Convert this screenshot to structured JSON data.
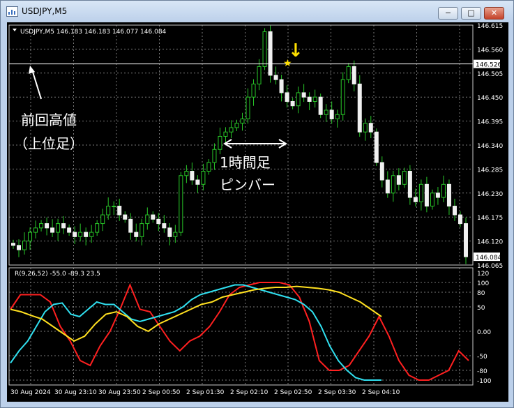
{
  "window": {
    "title": "USDJPY,M5",
    "buttons": {
      "minimize": "−",
      "maximize": "□",
      "close": "✕"
    }
  },
  "chart_data": {
    "type": "candlestick",
    "symbol_header": "USDJPY,M5  146.183 146.183 146.077 146.084",
    "price_axis": {
      "ylim": [
        146.065,
        146.615
      ],
      "ticks": [
        "146.615",
        "146.560",
        "146.505",
        "146.450",
        "146.395",
        "146.340",
        "146.285",
        "146.230",
        "146.175",
        "146.120",
        "146.065"
      ],
      "current_price": "146.084",
      "line_price": "146.526"
    },
    "time_axis": [
      "30 Aug 2024",
      "30 Aug 23:10",
      "30 Aug 23:50",
      "2 Sep 00:50",
      "2 Sep 01:30",
      "2 Sep 02:10",
      "2 Sep 02:50",
      "2 Sep 03:30",
      "2 Sep 04:10"
    ],
    "candle_close_series": [
      146.11,
      146.1,
      146.12,
      146.14,
      146.15,
      146.16,
      146.15,
      146.14,
      146.16,
      146.15,
      146.14,
      146.13,
      146.14,
      146.13,
      146.14,
      146.16,
      146.18,
      146.2,
      146.2,
      146.18,
      146.17,
      146.14,
      146.13,
      146.16,
      146.18,
      146.17,
      146.16,
      146.15,
      146.13,
      146.14,
      146.27,
      146.28,
      146.26,
      146.25,
      146.28,
      146.3,
      146.33,
      146.36,
      146.37,
      146.38,
      146.39,
      146.4,
      146.45,
      146.48,
      146.52,
      146.6,
      146.5,
      146.49,
      146.46,
      146.44,
      146.43,
      146.46,
      146.45,
      146.44,
      146.45,
      146.41,
      146.42,
      146.4,
      146.41,
      146.49,
      146.52,
      146.48,
      146.37,
      146.39,
      146.37,
      146.3,
      146.26,
      146.23,
      146.27,
      146.25,
      146.28,
      146.22,
      146.21,
      146.25,
      146.2,
      146.23,
      146.22,
      146.25,
      146.2,
      146.18,
      146.16,
      146.084
    ],
    "indicator": {
      "label": "R(9,26,52) -55.0 -89.3 23.5",
      "ylim": [
        -110,
        130
      ],
      "ticks": [
        "120",
        "100",
        "80",
        "50",
        "0.00",
        "-50",
        "-80",
        "-100"
      ],
      "series": [
        {
          "color": "#ff2020",
          "values": [
            45,
            75,
            75,
            75,
            60,
            10,
            -20,
            -60,
            -70,
            -30,
            0,
            45,
            95,
            45,
            40,
            10,
            -20,
            -40,
            -20,
            -10,
            10,
            40,
            75,
            90,
            95,
            100,
            100,
            100,
            95,
            70,
            20,
            -60,
            -80,
            -80,
            -70,
            -40,
            -10,
            30,
            -10,
            -60,
            -90,
            -100,
            -100,
            -90,
            -80,
            -40,
            -60
          ]
        },
        {
          "color": "#30e0f0",
          "values": [
            -65,
            -40,
            -20,
            10,
            40,
            55,
            58,
            35,
            30,
            45,
            60,
            55,
            55,
            40,
            25,
            20,
            25,
            30,
            35,
            40,
            50,
            65,
            75,
            80,
            85,
            90,
            95,
            95,
            90,
            85,
            80,
            75,
            70,
            65,
            55,
            40,
            10,
            -30,
            -60,
            -80,
            -95,
            -100,
            -100,
            -100
          ]
        },
        {
          "color": "#ffe020",
          "values": [
            45,
            40,
            32,
            25,
            10,
            -5,
            -20,
            -10,
            15,
            35,
            40,
            30,
            10,
            0,
            15,
            25,
            35,
            45,
            55,
            60,
            70,
            75,
            80,
            85,
            88,
            90,
            90,
            92,
            90,
            88,
            85,
            80,
            70,
            60,
            45,
            30
          ]
        }
      ]
    },
    "annotations": {
      "left_label": [
        "前回高値",
        "（上位足）"
      ],
      "center_label": [
        "1時間足",
        "ピンバー"
      ],
      "marker_arrow": "↓",
      "marker_star": "★"
    }
  }
}
